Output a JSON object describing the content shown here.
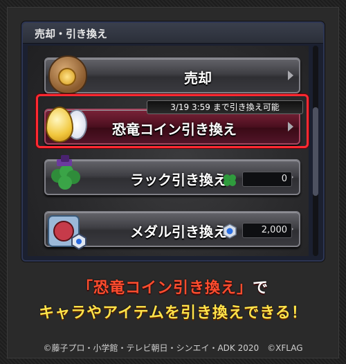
{
  "header": {
    "title": "売却・引き換え"
  },
  "menu": {
    "sell": {
      "label": "売却"
    },
    "dino": {
      "label": "恐竜コイン引き換え",
      "badge": "3/19 3:59 まで引き換え可能"
    },
    "luck": {
      "label": "ラック引き換え",
      "count": "0"
    },
    "medal": {
      "label": "メダル引き換え",
      "count": "2,000"
    }
  },
  "promo": {
    "line1_a": "「恐竜コイン引き換え」",
    "line1_b": "で",
    "line2": "キャラやアイテムを引き換えできる！"
  },
  "footer": {
    "copyright": "©藤子プロ・小学館・テレビ朝日・シンエイ・ADK 2020　©XFLAG"
  },
  "icons": {
    "sell": "money-bag-icon",
    "dino": "dino-egg-coin-icon",
    "luck": "clover-icon",
    "medal": "medal-icon"
  },
  "colors": {
    "highlight": "#ff2a32",
    "promo_red": "#ff4d2e",
    "promo_yellow": "#ffe34a"
  }
}
